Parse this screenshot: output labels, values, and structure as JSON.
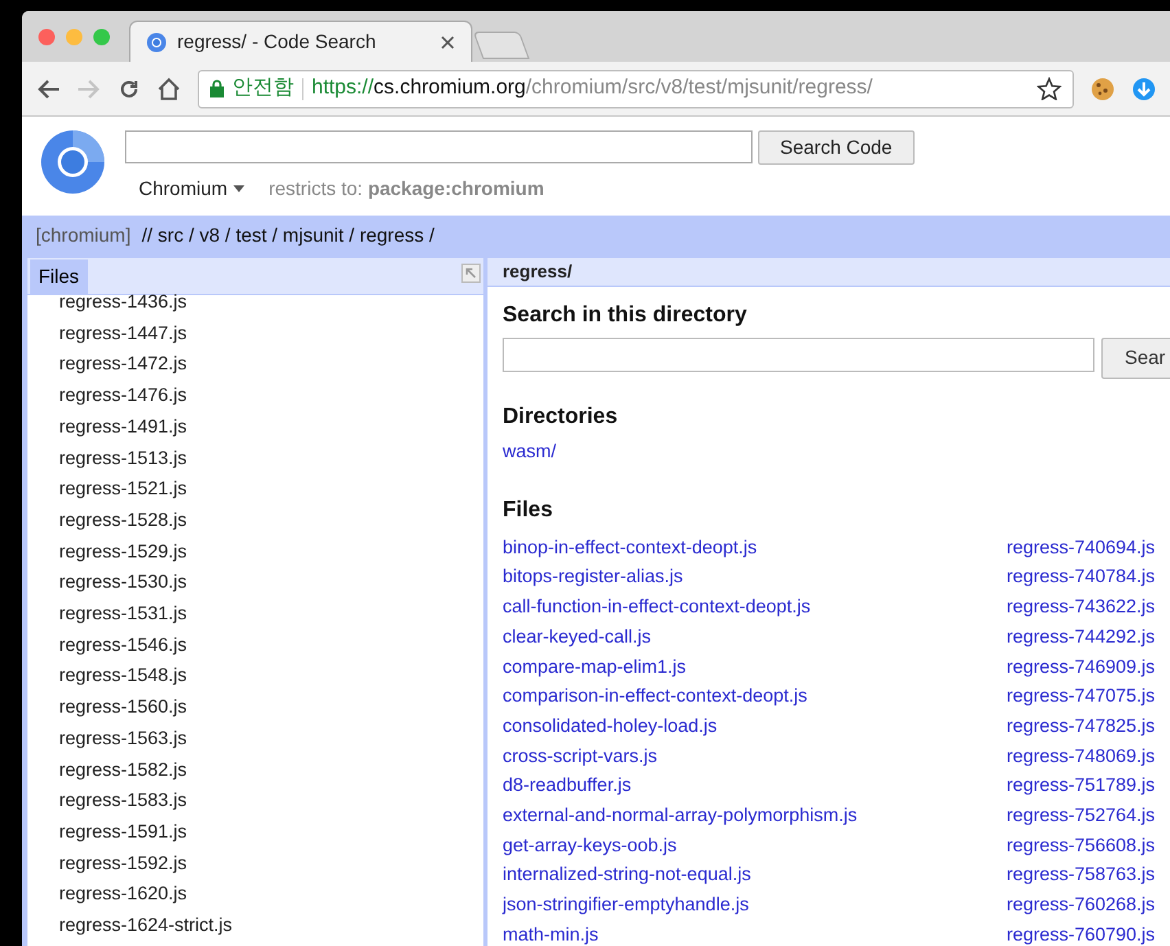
{
  "browser": {
    "tabs": [
      {
        "title": "regress/ - Code Search",
        "selected": true
      }
    ],
    "nav": {
      "forward_disabled": true
    },
    "address": {
      "security_label": "안전함",
      "scheme": "https://",
      "host": "cs.chromium.org",
      "path": "/chromium/src/v8/test/mjsunit/regress/"
    }
  },
  "search": {
    "button": "Search Code",
    "project": "Chromium",
    "restricts_label": "restricts to:",
    "restricts_value": "package:chromium"
  },
  "breadcrumb": {
    "root": "[chromium]",
    "path": "// src / v8 / test / mjsunit / regress /"
  },
  "file_tree": {
    "tab": "Files",
    "items": [
      "regress-1436.js",
      "regress-1447.js",
      "regress-1472.js",
      "regress-1476.js",
      "regress-1491.js",
      "regress-1513.js",
      "regress-1521.js",
      "regress-1528.js",
      "regress-1529.js",
      "regress-1530.js",
      "regress-1531.js",
      "regress-1546.js",
      "regress-1548.js",
      "regress-1560.js",
      "regress-1563.js",
      "regress-1582.js",
      "regress-1583.js",
      "regress-1591.js",
      "regress-1592.js",
      "regress-1620.js",
      "regress-1624-strict.js"
    ]
  },
  "directory": {
    "title": "regress/",
    "search_heading": "Search in this directory",
    "search_button": "Sear",
    "directories_heading": "Directories",
    "directories": [
      "wasm/"
    ],
    "files_heading": "Files",
    "files_col1": [
      "binop-in-effect-context-deopt.js",
      "bitops-register-alias.js",
      "call-function-in-effect-context-deopt.js",
      "clear-keyed-call.js",
      "compare-map-elim1.js",
      "comparison-in-effect-context-deopt.js",
      "consolidated-holey-load.js",
      "cross-script-vars.js",
      "d8-readbuffer.js",
      "external-and-normal-array-polymorphism.js",
      "get-array-keys-oob.js",
      "internalized-string-not-equal.js",
      "json-stringifier-emptyhandle.js",
      "math-min.js"
    ],
    "files_col2": [
      "regress-740694.js",
      "regress-740784.js",
      "regress-743622.js",
      "regress-744292.js",
      "regress-746909.js",
      "regress-747075.js",
      "regress-747825.js",
      "regress-748069.js",
      "regress-751789.js",
      "regress-752764.js",
      "regress-756608.js",
      "regress-758763.js",
      "regress-760268.js",
      "regress-760790.js"
    ]
  }
}
